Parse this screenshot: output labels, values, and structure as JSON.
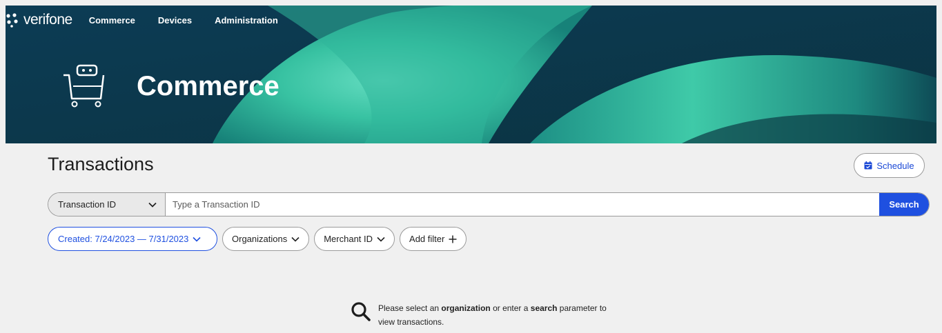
{
  "brand": {
    "name": "verifone"
  },
  "nav": {
    "items": [
      "Commerce",
      "Devices",
      "Administration"
    ]
  },
  "hero": {
    "title": "Commerce",
    "icon": "shopping-cart-icon"
  },
  "page": {
    "title": "Transactions"
  },
  "schedule": {
    "label": "Schedule",
    "icon": "calendar-icon"
  },
  "search": {
    "type_label": "Transaction ID",
    "placeholder": "Type a Transaction ID",
    "value": "",
    "button_label": "Search"
  },
  "filters": {
    "created": "Created: 7/24/2023 — 7/31/2023",
    "organizations": "Organizations",
    "merchant_id": "Merchant ID",
    "add_filter": "Add filter"
  },
  "empty_state": {
    "part1": "Please select an ",
    "bold1": "organization",
    "part2": " or enter a ",
    "bold2": "search",
    "part3": " parameter to",
    "line2": "view transactions."
  },
  "colors": {
    "accent": "#1f50e0",
    "hero_dark": "#0f4a63",
    "hero_teal": "#3ec9a6"
  }
}
